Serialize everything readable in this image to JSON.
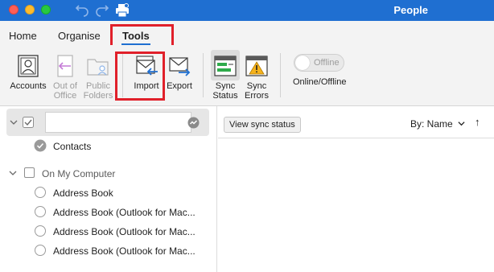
{
  "window": {
    "title": "People"
  },
  "tabs": [
    {
      "label": "Home"
    },
    {
      "label": "Organise"
    },
    {
      "label": "Tools"
    }
  ],
  "ribbon": {
    "accounts": "Accounts",
    "out_of_office": [
      "Out of",
      "Office"
    ],
    "public_folders": [
      "Public",
      "Folders"
    ],
    "import": "Import",
    "export": "Export",
    "sync_status": [
      "Sync",
      "Status"
    ],
    "sync_errors": [
      "Sync",
      "Errors"
    ],
    "offline_toggle": "Offline",
    "online_offline": "Online/Offline"
  },
  "sidebar": {
    "account_items": [
      {
        "label": "Contacts"
      }
    ],
    "on_my_computer": "On My Computer",
    "local_items": [
      {
        "label": "Address Book"
      },
      {
        "label": "Address Book (Outlook for Mac..."
      },
      {
        "label": "Address Book (Outlook for Mac..."
      },
      {
        "label": "Address Book (Outlook for Mac..."
      }
    ]
  },
  "main": {
    "tooltip": "View sync status",
    "sort_label": "By: Name",
    "sort_direction_icon": "↑"
  },
  "colors": {
    "accent": "#1f6fd1",
    "highlight": "#e0202a"
  }
}
